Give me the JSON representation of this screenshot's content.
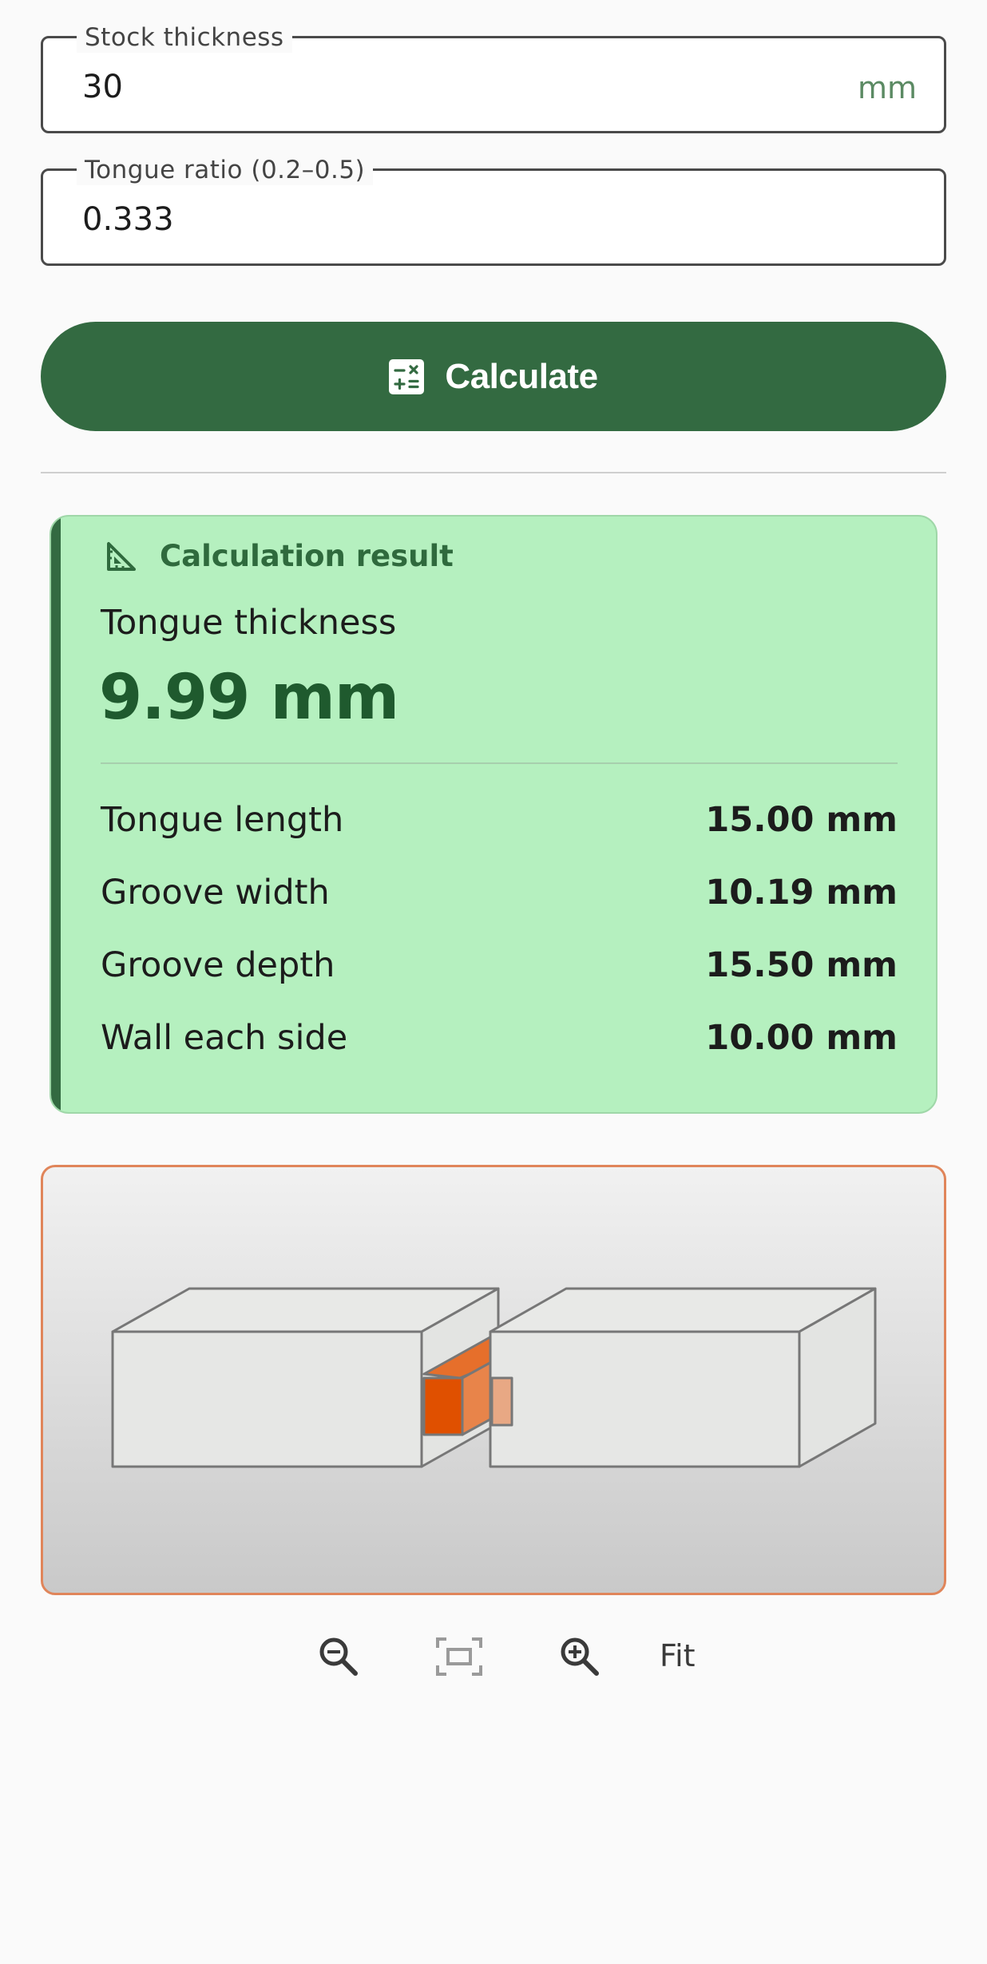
{
  "form": {
    "stock_thickness": {
      "label": "Stock thickness",
      "value": "30",
      "suffix": "mm"
    },
    "tongue_ratio": {
      "label": "Tongue ratio (0.2–0.5)",
      "value": "0.333"
    },
    "calculate_label": "Calculate"
  },
  "result": {
    "title": "Calculation result",
    "primary_label": "Tongue thickness",
    "primary_value": "9.99 mm",
    "rows": [
      {
        "label": "Tongue length",
        "value": "15.00 mm"
      },
      {
        "label": "Groove width",
        "value": "10.19 mm"
      },
      {
        "label": "Groove depth",
        "value": "15.50 mm"
      },
      {
        "label": "Wall each side",
        "value": "10.00 mm"
      }
    ]
  },
  "viewer": {
    "colors": {
      "border": "#e0855a",
      "groove": "#e05000",
      "tongue": "#e8a884",
      "stock": "#e6e7e5"
    }
  },
  "toolbar": {
    "icons": [
      "zoom-out-icon",
      "fit-frame-icon",
      "zoom-in-icon"
    ],
    "fit_label": "Fit"
  },
  "colors": {
    "accent": "#336a41",
    "result_bg": "#b5f0bf",
    "background": "#fafafa"
  }
}
